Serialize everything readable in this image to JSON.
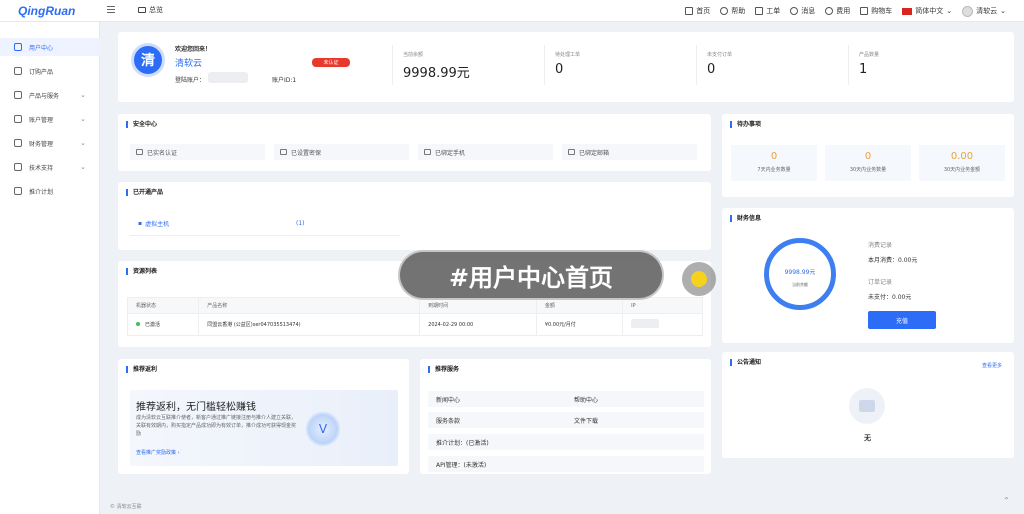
{
  "brand": "QingRuan",
  "header": {
    "home_tab": "总览",
    "nav": [
      {
        "icon": "monitor-icon",
        "label": "首页"
      },
      {
        "icon": "help-icon",
        "label": "帮助"
      },
      {
        "icon": "ticket-icon",
        "label": "工单"
      },
      {
        "icon": "bell-icon",
        "label": "消息"
      },
      {
        "icon": "fee-icon",
        "label": "费用"
      },
      {
        "icon": "cart-icon",
        "label": "购物车"
      }
    ],
    "language": "简体中文",
    "user": "清软云"
  },
  "sidebar": {
    "items": [
      {
        "label": "用户中心",
        "active": true,
        "has_children": false,
        "icon": "grid-icon"
      },
      {
        "label": "订购产品",
        "active": false,
        "has_children": false,
        "icon": "cart-icon"
      },
      {
        "label": "产品与服务",
        "active": false,
        "has_children": true,
        "icon": "apps-icon"
      },
      {
        "label": "账户管理",
        "active": false,
        "has_children": true,
        "icon": "user-icon"
      },
      {
        "label": "财务管理",
        "active": false,
        "has_children": true,
        "icon": "finance-icon"
      },
      {
        "label": "技术支持",
        "active": false,
        "has_children": true,
        "icon": "support-icon"
      },
      {
        "label": "推介计划",
        "active": false,
        "has_children": false,
        "icon": "send-icon"
      }
    ]
  },
  "welcome": {
    "avatar_char": "清",
    "greeting": "欢迎您回来！",
    "name": "清软云",
    "badge": "未认证",
    "login_account_label": "登陆账户：",
    "account_id_label": "账户ID:1",
    "stats": [
      {
        "label": "当前余额",
        "value": "9998.99元"
      },
      {
        "label": "待处理工单",
        "value": "0"
      },
      {
        "label": "未支付订单",
        "value": "0"
      },
      {
        "label": "产品数量",
        "value": "1"
      }
    ]
  },
  "security": {
    "title": "安全中心",
    "items": [
      "已实名认证",
      "已设置密保",
      "已绑定手机",
      "已绑定邮箱"
    ]
  },
  "products": {
    "title": "已开通产品",
    "item": "虚拟主机",
    "count": "(1)"
  },
  "resources": {
    "title": "资源列表",
    "columns": [
      "机器状态",
      "产品名称",
      "到期时间",
      "金额",
      "IP"
    ],
    "rows": [
      {
        "status": "已激活",
        "name": "同盟云香港 (公益区)ser047035513474)",
        "expire": "2024-02-29 00:00",
        "amount": "¥0.00元/月付",
        "ip": ""
      }
    ]
  },
  "rebate": {
    "title": "推荐返利",
    "headline": "推荐返利，无门槛轻松赚钱",
    "desc": "成为清软云互联推介使者，新客户通过推广链接注册与推介人建立关联，关联有效期内，购买指定产品成功即为有效订单，推介成功可获得现金奖励",
    "link": "查看推广奖励政策 ›"
  },
  "services": {
    "title": "推荐服务",
    "items": [
      "新闻中心",
      "帮助中心",
      "服务条款",
      "文件下载",
      "推介计划：(已激活)",
      "API管理：(未激活)"
    ]
  },
  "todo": {
    "title": "待办事项",
    "items": [
      {
        "value": "0",
        "label": "7天内业务数量"
      },
      {
        "value": "0",
        "label": "30天内业务数量"
      },
      {
        "value": "0.00",
        "label": "30天内业务金额"
      }
    ]
  },
  "finance": {
    "title": "财务信息",
    "ring_value": "9998.99元",
    "ring_label": "当前余额",
    "consume_title": "消费记录",
    "consume_text": "本月消费：0.00元",
    "order_title": "订单记录",
    "order_text": "未支付：0.00元",
    "recharge": "充值"
  },
  "notice": {
    "title": "公告通知",
    "more": "查看更多",
    "empty": "无"
  },
  "overlay_caption": "#用户中心首页",
  "footer": "© 清软云互联",
  "colors": {
    "accent": "#2c6cf6",
    "badge": "#e8392f",
    "todo_value": "#e6a23c",
    "status_green": "#3fbf5b"
  }
}
